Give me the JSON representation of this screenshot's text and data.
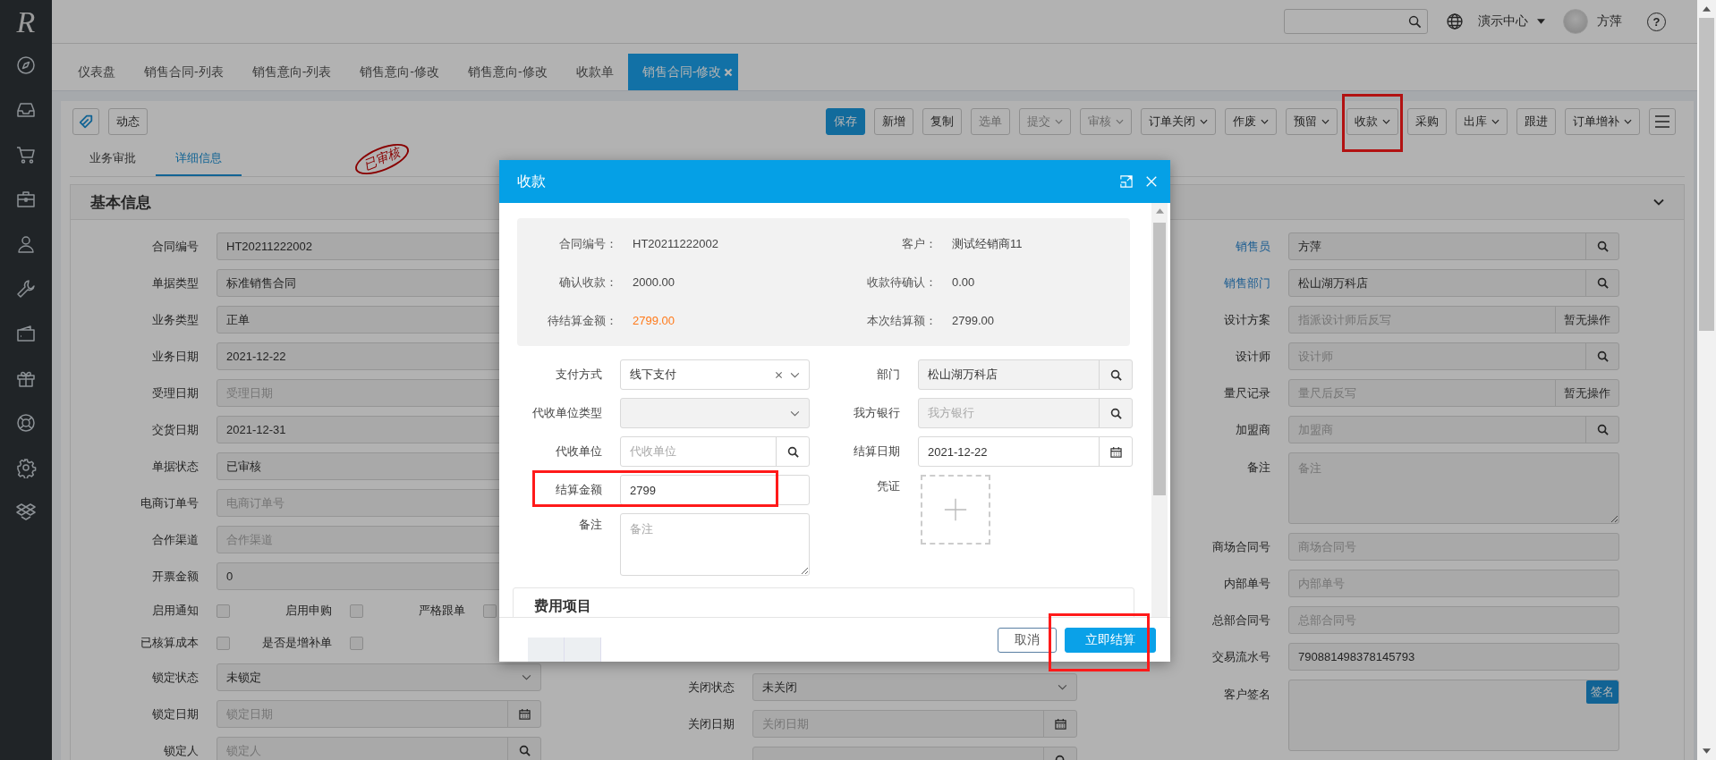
{
  "logo": "R",
  "header": {
    "org_menu": "演示中心",
    "user": "方萍",
    "help": "?"
  },
  "tabs": [
    {
      "label": "仪表盘",
      "selected": false,
      "closable": false
    },
    {
      "label": "销售合同-列表",
      "selected": false,
      "closable": false
    },
    {
      "label": "销售意向-列表",
      "selected": false,
      "closable": false
    },
    {
      "label": "销售意向-修改",
      "selected": false,
      "closable": false
    },
    {
      "label": "销售意向-修改",
      "selected": false,
      "closable": false
    },
    {
      "label": "收款单",
      "selected": false,
      "closable": false
    },
    {
      "label": "销售合同-修改",
      "selected": true,
      "closable": true
    }
  ],
  "toolbar": {
    "activity": "动态",
    "buttons": [
      {
        "label": "保存",
        "primary": true,
        "disabled": false,
        "dropdown": false,
        "highlighted": false
      },
      {
        "label": "新增",
        "primary": false,
        "disabled": false,
        "dropdown": false,
        "highlighted": false
      },
      {
        "label": "复制",
        "primary": false,
        "disabled": false,
        "dropdown": false,
        "highlighted": false
      },
      {
        "label": "选单",
        "primary": false,
        "disabled": true,
        "dropdown": false,
        "highlighted": false
      },
      {
        "label": "提交",
        "primary": false,
        "disabled": true,
        "dropdown": true,
        "highlighted": false
      },
      {
        "label": "审核",
        "primary": false,
        "disabled": true,
        "dropdown": true,
        "highlighted": false
      },
      {
        "label": "订单关闭",
        "primary": false,
        "disabled": false,
        "dropdown": true,
        "highlighted": false
      },
      {
        "label": "作废",
        "primary": false,
        "disabled": false,
        "dropdown": true,
        "highlighted": false
      },
      {
        "label": "预留",
        "primary": false,
        "disabled": false,
        "dropdown": true,
        "highlighted": false
      },
      {
        "label": "收款",
        "primary": false,
        "disabled": false,
        "dropdown": true,
        "highlighted": true
      },
      {
        "label": "采购",
        "primary": false,
        "disabled": false,
        "dropdown": false,
        "highlighted": false
      },
      {
        "label": "出库",
        "primary": false,
        "disabled": false,
        "dropdown": true,
        "highlighted": false
      },
      {
        "label": "跟进",
        "primary": false,
        "disabled": false,
        "dropdown": false,
        "highlighted": false
      },
      {
        "label": "订单增补",
        "primary": false,
        "disabled": false,
        "dropdown": true,
        "highlighted": false
      }
    ]
  },
  "subtabs": [
    {
      "label": "业务审批",
      "selected": false
    },
    {
      "label": "详细信息",
      "selected": true
    }
  ],
  "stamp": "已审核",
  "basic_info": {
    "title": "基本信息",
    "left": [
      {
        "kind": "text",
        "label": "合同编号",
        "value": "HT20211222002"
      },
      {
        "kind": "text",
        "label": "单据类型",
        "value": "标准销售合同"
      },
      {
        "kind": "text",
        "label": "业务类型",
        "value": "正单"
      },
      {
        "kind": "text",
        "label": "业务日期",
        "value": "2021-12-22"
      },
      {
        "kind": "text",
        "label": "受理日期",
        "placeholder": "受理日期"
      },
      {
        "kind": "text",
        "label": "交货日期",
        "value": "2021-12-31"
      },
      {
        "kind": "text",
        "label": "单据状态",
        "value": "已审核"
      },
      {
        "kind": "text",
        "label": "电商订单号",
        "placeholder": "电商订单号"
      },
      {
        "kind": "text",
        "label": "合作渠道",
        "placeholder": "合作渠道"
      },
      {
        "kind": "text",
        "label": "开票金额",
        "value": "0"
      },
      {
        "kind": "checks",
        "items": [
          {
            "label": "启用通知",
            "checked": false
          },
          {
            "label": "启用申购",
            "checked": false
          },
          {
            "label": "严格跟单",
            "checked": false
          }
        ]
      },
      {
        "kind": "checks",
        "items": [
          {
            "label": "已核算成本",
            "checked": false
          },
          {
            "label": "是否是增补单",
            "checked": false
          }
        ]
      },
      {
        "kind": "select",
        "label": "锁定状态",
        "value": "未锁定"
      },
      {
        "kind": "date",
        "label": "锁定日期",
        "placeholder": "锁定日期"
      },
      {
        "kind": "lookup",
        "label": "锁定人",
        "placeholder": "锁定人"
      }
    ],
    "middle": [
      {
        "kind": "select",
        "label": "关闭状态",
        "value": "未关闭"
      },
      {
        "kind": "date",
        "label": "关闭日期",
        "placeholder": "关闭日期"
      },
      {
        "kind": "lookup"
      }
    ],
    "right": [
      {
        "kind": "lookup",
        "label": "销售员",
        "value": "方萍",
        "link": true
      },
      {
        "kind": "lookup",
        "label": "销售部门",
        "value": "松山湖万科店",
        "link": true
      },
      {
        "kind": "action",
        "label": "设计方案",
        "placeholder": "指派设计师后反写",
        "action": "暂无操作",
        "link": false
      },
      {
        "kind": "lookup",
        "label": "设计师",
        "placeholder": "设计师",
        "link": false
      },
      {
        "kind": "action",
        "label": "量尺记录",
        "placeholder": "量尺后反写",
        "action": "暂无操作",
        "link": false
      },
      {
        "kind": "lookup",
        "label": "加盟商",
        "placeholder": "加盟商",
        "link": false
      },
      {
        "kind": "textarea",
        "label": "备注",
        "placeholder": "备注",
        "link": false
      },
      {
        "kind": "text",
        "label": "商场合同号",
        "placeholder": "商场合同号",
        "link": false
      },
      {
        "kind": "text",
        "label": "内部单号",
        "placeholder": "内部单号",
        "link": false
      },
      {
        "kind": "text",
        "label": "总部合同号",
        "placeholder": "总部合同号",
        "link": false
      },
      {
        "kind": "text",
        "label": "交易流水号",
        "value": "790881498378145793",
        "link": false
      },
      {
        "kind": "signature",
        "label": "客户签名",
        "button": "签名",
        "link": false
      }
    ]
  },
  "modal": {
    "title": "收款",
    "summary": [
      {
        "label": "合同编号：",
        "value": "HT20211222002",
        "emphasis": false
      },
      {
        "label": "客户：",
        "value": "测试经销商11",
        "emphasis": false
      },
      {
        "label": "确认收款：",
        "value": "2000.00",
        "emphasis": false
      },
      {
        "label": "收款待确认：",
        "value": "0.00",
        "emphasis": false
      },
      {
        "label": "待结算金额：",
        "value": "2799.00",
        "emphasis": true
      },
      {
        "label": "本次结算额：",
        "value": "2799.00",
        "emphasis": false
      }
    ],
    "form_left": [
      {
        "kind": "select",
        "label": "支付方式",
        "value": "线下支付",
        "clearable": true,
        "disabled": false,
        "highlighted": false
      },
      {
        "kind": "select",
        "label": "代收单位类型",
        "clearable": false,
        "disabled": true,
        "highlighted": false
      },
      {
        "kind": "lookup",
        "label": "代收单位",
        "placeholder": "代收单位",
        "disabled": false,
        "highlighted": false
      },
      {
        "kind": "text",
        "label": "结算金额",
        "value": "2799",
        "disabled": false,
        "highlighted": true
      },
      {
        "kind": "textarea",
        "label": "备注",
        "placeholder": "备注",
        "disabled": false,
        "highlighted": false
      }
    ],
    "form_right": [
      {
        "kind": "lookup",
        "label": "部门",
        "value": "松山湖万科店",
        "disabled": true,
        "highlighted": false
      },
      {
        "kind": "lookup",
        "label": "我方银行",
        "placeholder": "我方银行",
        "disabled": true,
        "highlighted": false
      },
      {
        "kind": "date",
        "label": "结算日期",
        "value": "2021-12-22",
        "disabled": false,
        "highlighted": false
      },
      {
        "kind": "upload",
        "label": "凭证",
        "disabled": false,
        "highlighted": false
      }
    ],
    "section": "费用项目",
    "buttons": [
      {
        "label": "取消",
        "primary": false,
        "highlighted": false
      },
      {
        "label": "立即结算",
        "primary": true,
        "highlighted": true
      }
    ]
  }
}
